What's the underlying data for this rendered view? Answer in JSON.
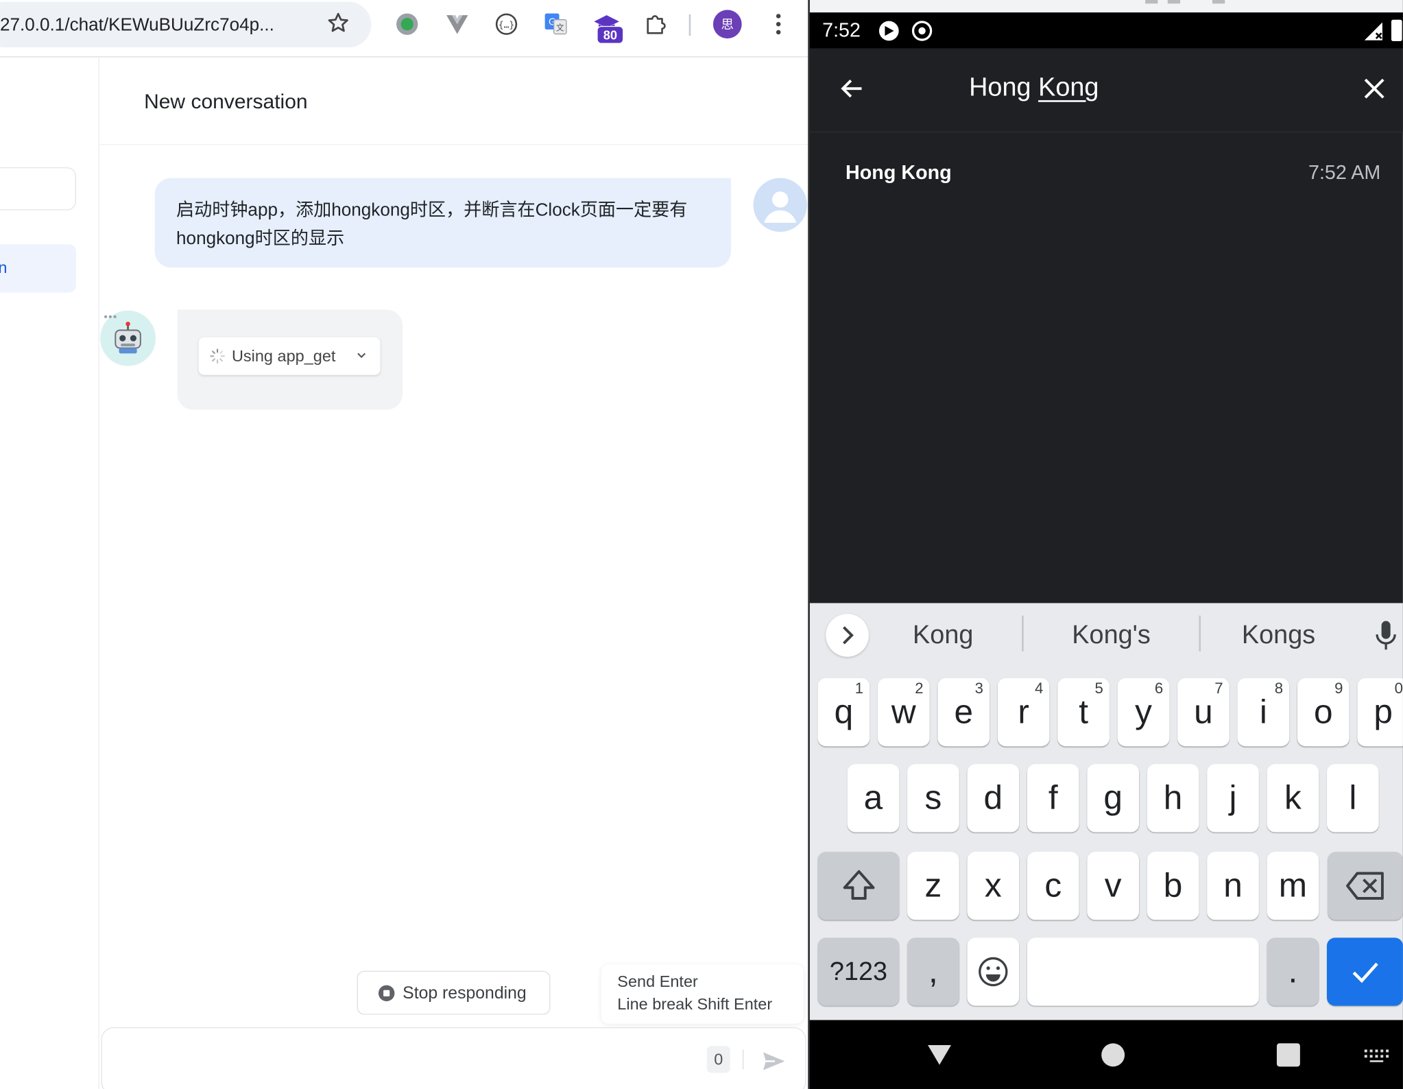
{
  "browser": {
    "url": "27.0.0.1/chat/KEWuBUuZrc7o4p...",
    "profile_initial": "思",
    "extension_badge": "80",
    "conversation_title": "New conversation",
    "sidebar_active_label": "n",
    "user_message": "启动时钟app，添加hongkong时区，并断言在Clock页面一定要有hongkong时区的显示",
    "bot_dots": "•••",
    "tool_chip_label": "Using app_get",
    "stop_label": "Stop responding",
    "send_hint_line1": "Send Enter",
    "send_hint_line2": "Line break Shift Enter",
    "char_count": "0"
  },
  "phone": {
    "status_time": "7:52",
    "search_query_part1": "Hong ",
    "search_query_part2": "Kong",
    "result": {
      "city": "Hong Kong",
      "time": "7:52 AM"
    },
    "suggestions": [
      "Kong",
      "Kong's",
      "Kongs"
    ],
    "keyboard": {
      "row1": [
        [
          "q",
          "1"
        ],
        [
          "w",
          "2"
        ],
        [
          "e",
          "3"
        ],
        [
          "r",
          "4"
        ],
        [
          "t",
          "5"
        ],
        [
          "y",
          "6"
        ],
        [
          "u",
          "7"
        ],
        [
          "i",
          "8"
        ],
        [
          "o",
          "9"
        ],
        [
          "p",
          "0"
        ]
      ],
      "row2": [
        "a",
        "s",
        "d",
        "f",
        "g",
        "h",
        "j",
        "k",
        "l"
      ],
      "row3": [
        "z",
        "x",
        "c",
        "v",
        "b",
        "n",
        "m"
      ],
      "sym_key": "?123",
      "comma_key": ",",
      "period_key": "."
    }
  }
}
